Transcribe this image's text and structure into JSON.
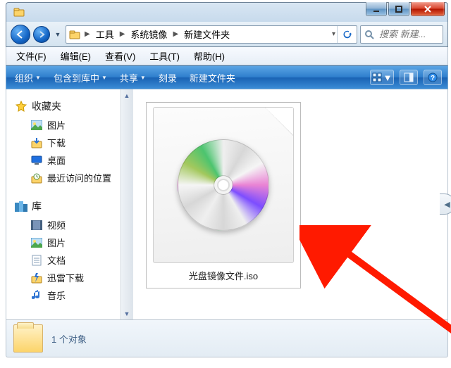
{
  "titlebar": {
    "icon": "folder"
  },
  "nav": {
    "crumbs": [
      "工具",
      "系统镜像",
      "新建文件夹"
    ],
    "search_placeholder": "搜索 新建..."
  },
  "menu": {
    "file": "文件(F)",
    "edit": "编辑(E)",
    "view": "查看(V)",
    "tools": "工具(T)",
    "help": "帮助(H)"
  },
  "toolbar": {
    "organize": "组织",
    "include": "包含到库中",
    "share": "共享",
    "burn": "刻录",
    "new_folder": "新建文件夹"
  },
  "sidebar": {
    "favorites_label": "收藏夹",
    "favorites": [
      {
        "icon": "pictures",
        "label": "图片"
      },
      {
        "icon": "download",
        "label": "下载"
      },
      {
        "icon": "desktop",
        "label": "桌面"
      },
      {
        "icon": "recent",
        "label": "最近访问的位置"
      }
    ],
    "libraries_label": "库",
    "libraries": [
      {
        "icon": "video",
        "label": "视频"
      },
      {
        "icon": "pictures",
        "label": "图片"
      },
      {
        "icon": "docs",
        "label": "文档"
      },
      {
        "icon": "xunlei",
        "label": "迅雷下载"
      },
      {
        "icon": "music",
        "label": "音乐"
      }
    ]
  },
  "content": {
    "items": [
      {
        "name": "光盘镜像文件.iso",
        "type": "iso"
      }
    ]
  },
  "status": {
    "count_text": "1 个对象"
  }
}
